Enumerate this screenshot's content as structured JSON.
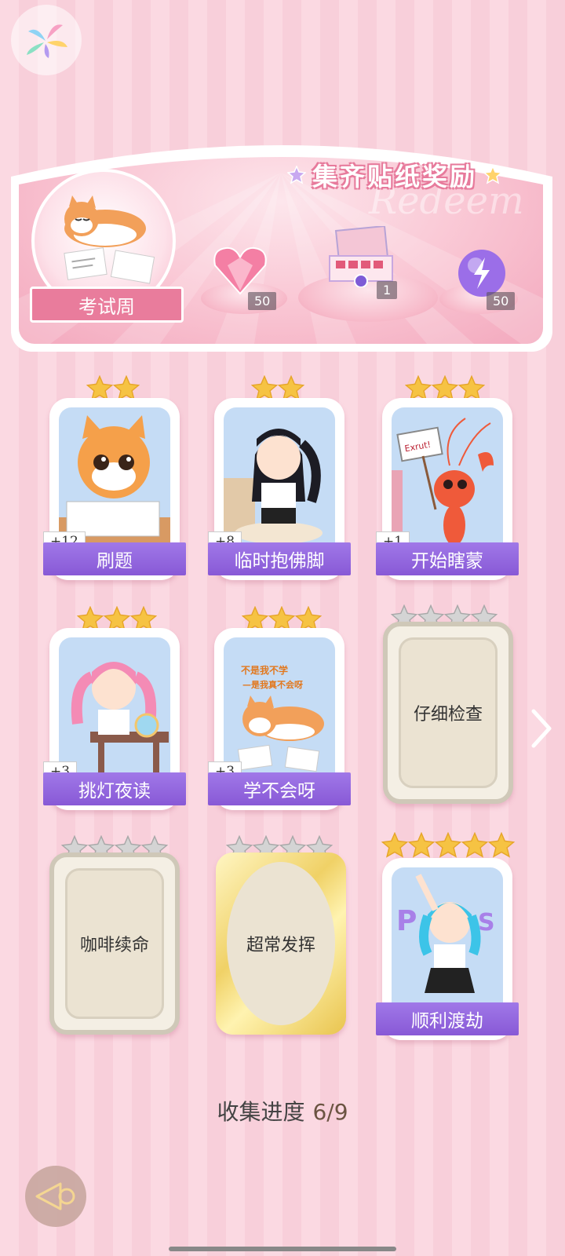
{
  "banner": {
    "title": "集齐贴纸奖励",
    "watermark": "Redeem",
    "theme_label": "考试周",
    "rewards": [
      {
        "icon": "pink-heart-gem-icon",
        "count": "50"
      },
      {
        "icon": "gift-box-icon",
        "count": "1"
      },
      {
        "icon": "purple-energy-orb-icon",
        "count": "50"
      }
    ]
  },
  "cards": [
    {
      "name": "刷题",
      "bonus": "+12",
      "stars": 2,
      "state": "collected",
      "icon": "cat-writing-icon"
    },
    {
      "name": "临时抱佛脚",
      "bonus": "+8",
      "stars": 2,
      "state": "collected",
      "icon": "girl-praying-icon"
    },
    {
      "name": "开始瞎蒙",
      "bonus": "+1",
      "stars": 3,
      "state": "collected",
      "icon": "lobster-sign-icon",
      "sign_text": "Exrut!"
    },
    {
      "name": "挑灯夜读",
      "bonus": "+3",
      "stars": 3,
      "state": "collected",
      "icon": "girl-studying-icon"
    },
    {
      "name": "学不会呀",
      "bonus": "+3",
      "stars": 3,
      "state": "collected",
      "icon": "shiba-lying-icon",
      "caption_line1": "不是我不学",
      "caption_line2": "—是我真不会呀"
    },
    {
      "name": "仔细检查",
      "stars": 4,
      "state": "locked"
    },
    {
      "name": "咖啡续命",
      "stars": 4,
      "state": "locked"
    },
    {
      "name": "超常发挥",
      "stars": 4,
      "state": "locked-gold"
    },
    {
      "name": "顺利渡劫",
      "stars": 5,
      "state": "collected",
      "icon": "blue-hair-girl-icon"
    }
  ],
  "progress": {
    "label": "收集进度",
    "value": "6/9"
  },
  "colors": {
    "accent_purple": "#8859d6",
    "banner_pink": "#e97c9c",
    "star_gold": "#f6c343",
    "star_grey": "#c8c8c8"
  }
}
